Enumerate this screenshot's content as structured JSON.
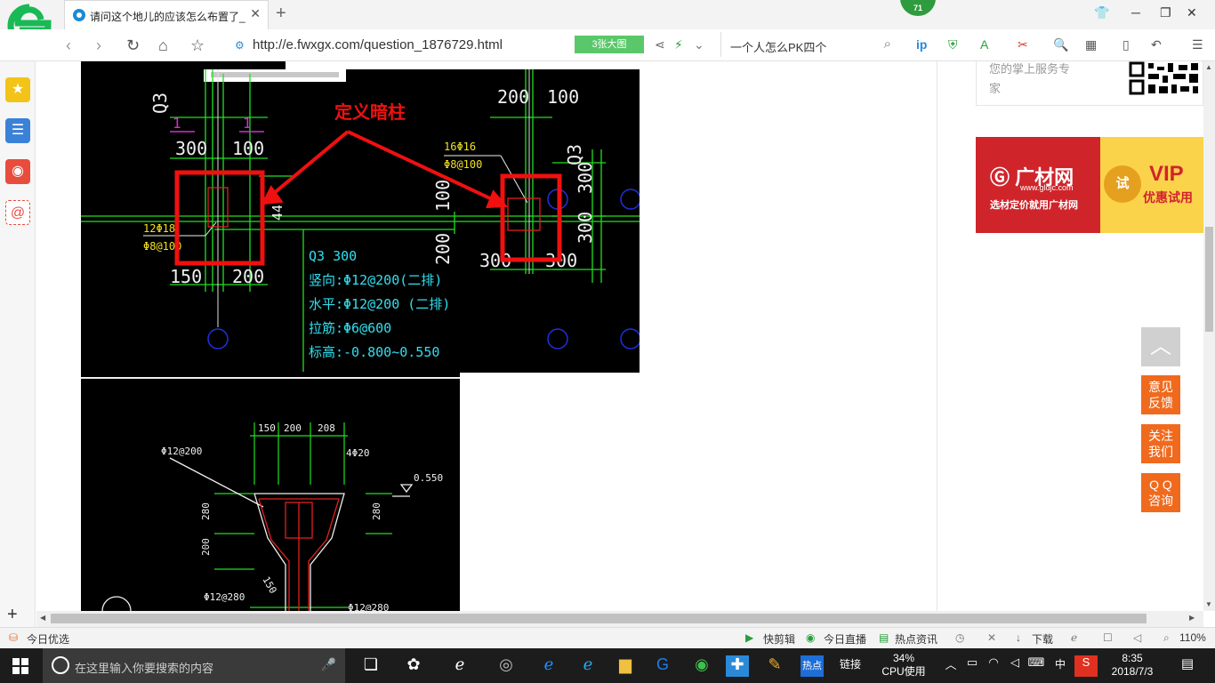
{
  "tab": {
    "title": "请问这个地儿的应该怎么布置了_"
  },
  "notification_count": "71",
  "address": {
    "url": "http://e.fwxgx.com/question_1876729.html",
    "big_image_btn": "3张大图",
    "search_text": "一个人怎么PK四个"
  },
  "right_panel": {
    "service_text_1": "您的掌上服务专",
    "service_text_2": "家"
  },
  "ad": {
    "brand": "广材网",
    "domain": "www.gldjc.com",
    "slogan": "选材定价就用广材网",
    "trial": "试",
    "vip": "VIP",
    "vip_sub": "优惠试用"
  },
  "float_buttons": {
    "feedback": "意见\n反馈",
    "follow": "关注\n我们",
    "qq": "Q Q\n咨询"
  },
  "cad": {
    "top_dims_left": [
      "300",
      "100"
    ],
    "top_dims_right": [
      "200",
      "100"
    ],
    "q3_left": "Q3",
    "q3_right": "Q3",
    "one_left": "1",
    "one_right": "1",
    "annotation": "定义暗柱",
    "rebar_left": [
      "12Φ18",
      "Φ8@100"
    ],
    "rebar_right": [
      "16Φ16",
      "Φ8@100"
    ],
    "bottom_dims_left": [
      "150",
      "200"
    ],
    "bottom_dims_right": [
      "300",
      "300"
    ],
    "side_dims_right": [
      "300",
      "300"
    ],
    "mid_dims": [
      "100",
      "200"
    ],
    "dim_44": "44",
    "wall_spec": [
      "Q3 300",
      "竖向:Φ12@200(二排)",
      "水平:Φ12@200 (二排)",
      "拉筋:Φ6@600",
      "标高:-0.800~0.550"
    ],
    "detail_top_dims": [
      "150",
      "200",
      "208"
    ],
    "detail_labels": [
      "Φ12@200",
      "4Φ20",
      "0.550",
      "280",
      "200",
      "280",
      "Φ12@280",
      "Φ12@280",
      "150"
    ]
  },
  "status": {
    "left": "今日优选",
    "quick_cut": "快剪辑",
    "live": "今日直播",
    "hot": "热点资讯",
    "download": "下载",
    "zoom": "110%"
  },
  "taskbar": {
    "search_placeholder": "在这里输入你要搜索的内容",
    "link": "链接",
    "cpu_pct": "34%",
    "cpu_label": "CPU使用",
    "ime": "中",
    "time": "8:35",
    "date": "2018/7/3",
    "hotpoint": "热点"
  }
}
